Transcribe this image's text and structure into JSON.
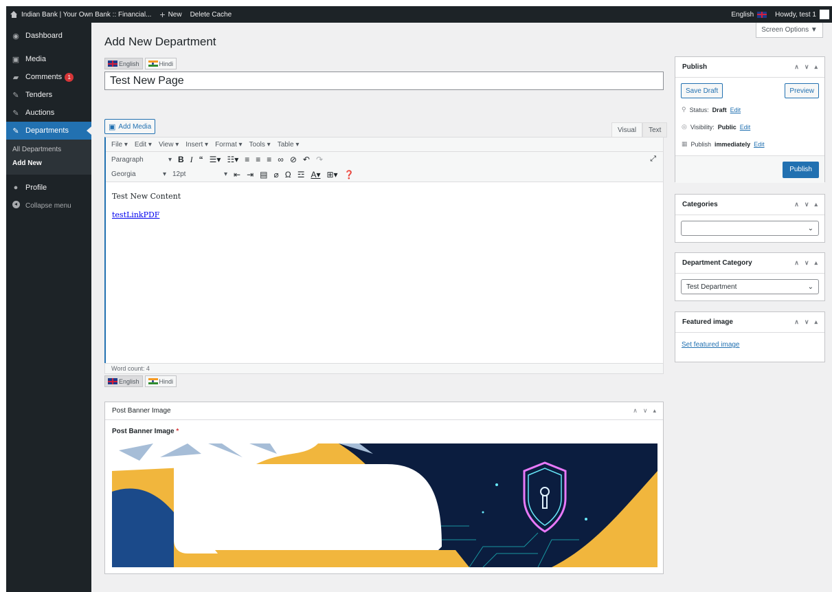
{
  "adminbar": {
    "site_name": "Indian Bank | Your Own Bank :: Financial...",
    "new_label": "New",
    "delete_cache": "Delete Cache",
    "language": "English",
    "howdy": "Howdy, test 1"
  },
  "sidebar": {
    "dashboard": "Dashboard",
    "media": "Media",
    "comments": "Comments",
    "comments_count": "1",
    "tenders": "Tenders",
    "auctions": "Auctions",
    "departments": "Departments",
    "sub_all": "All Departments",
    "sub_add": "Add New",
    "profile": "Profile",
    "collapse": "Collapse menu"
  },
  "screen_options": "Screen Options ▼",
  "page_title": "Add New Department",
  "lang_tabs": {
    "english": "English",
    "hindi": "Hindi"
  },
  "title_value": "Test New Page",
  "editor": {
    "add_media": "Add Media",
    "tab_visual": "Visual",
    "tab_text": "Text",
    "menu": [
      "File ▾",
      "Edit ▾",
      "View ▾",
      "Insert ▾",
      "Format ▾",
      "Tools ▾",
      "Table ▾"
    ],
    "format_select": "Paragraph",
    "font_select": "Georgia",
    "size_select": "12pt",
    "content_text": "Test New Content",
    "content_link": "testLinkPDF",
    "word_count": "Word count: 4"
  },
  "banner_box": {
    "header": "Post Banner Image",
    "label": "Post Banner Image",
    "required": "*"
  },
  "publish": {
    "title": "Publish",
    "save_draft": "Save Draft",
    "preview": "Preview",
    "status_label": "Status:",
    "status_value": "Draft",
    "visibility_label": "Visibility:",
    "visibility_value": "Public",
    "schedule_label": "Publish",
    "schedule_value": "immediately",
    "edit": "Edit",
    "publish_button": "Publish"
  },
  "categories": {
    "title": "Categories",
    "value": ""
  },
  "dept_category": {
    "title": "Department Category",
    "value": "Test Department"
  },
  "featured": {
    "title": "Featured image",
    "link": "Set featured image"
  },
  "colors": {
    "accent": "#2271b1",
    "adminbar": "#1d2327",
    "banner_navy": "#0b1d3f",
    "banner_yellow": "#f1b63d"
  }
}
